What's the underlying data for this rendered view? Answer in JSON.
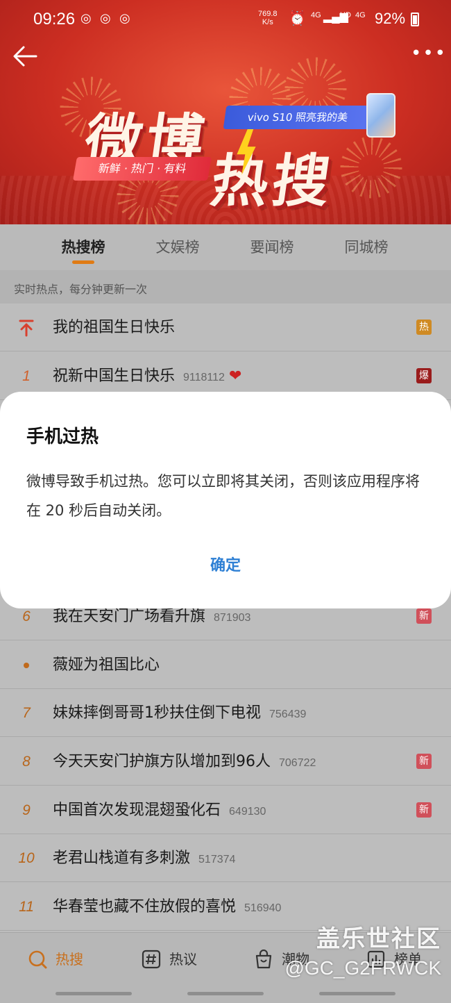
{
  "status_bar": {
    "time": "09:26",
    "net_speed_value": "769.8",
    "net_speed_unit": "K/s",
    "signal1": "4G",
    "hd": "HD",
    "signal2": "4G",
    "battery": "92%",
    "notification_icons": [
      "weibo-icon",
      "weibo-icon",
      "weibo-icon"
    ]
  },
  "banner": {
    "title_line1": "微博",
    "title_line2": "热搜",
    "slogan": "新鲜 · 热门 · 有料",
    "ad_text": "vivo S10 照亮我的美"
  },
  "tabs": [
    {
      "label": "热搜榜",
      "active": true
    },
    {
      "label": "文娱榜",
      "active": false
    },
    {
      "label": "要闻榜",
      "active": false
    },
    {
      "label": "同城榜",
      "active": false
    }
  ],
  "subinfo": "实时热点，每分钟更新一次",
  "list": [
    {
      "rank": "",
      "type": "pinned",
      "title": "我的祖国生日快乐",
      "count": "",
      "tag": "热",
      "tag_type": "hot"
    },
    {
      "rank": "1",
      "type": "num",
      "title": "祝新中国生日快乐",
      "count": "9118112",
      "heart": "❤",
      "tag": "爆",
      "tag_type": "boom"
    },
    {
      "rank": "6",
      "type": "num",
      "title": "我在天安门广场看升旗",
      "count": "871903",
      "tag": "新",
      "tag_type": "new"
    },
    {
      "rank": "",
      "type": "dot",
      "title": "薇娅为祖国比心",
      "count": "",
      "tag": "",
      "tag_type": ""
    },
    {
      "rank": "7",
      "type": "num",
      "title": "妹妹摔倒哥哥1秒扶住倒下电视",
      "count": "756439",
      "tag": "",
      "tag_type": ""
    },
    {
      "rank": "8",
      "type": "num",
      "title": "今天天安门护旗方队增加到96人",
      "count": "706722",
      "tag": "新",
      "tag_type": "new"
    },
    {
      "rank": "9",
      "type": "num",
      "title": "中国首次发现混翅蛩化石",
      "count": "649130",
      "tag": "新",
      "tag_type": "new"
    },
    {
      "rank": "10",
      "type": "num",
      "title": "老君山栈道有多刺激",
      "count": "517374",
      "tag": "",
      "tag_type": ""
    },
    {
      "rank": "11",
      "type": "num",
      "title": "华春莹也藏不住放假的喜悦",
      "count": "516940",
      "tag": "",
      "tag_type": ""
    }
  ],
  "dialog": {
    "title": "手机过热",
    "message": "微博导致手机过热。您可以立即将其关闭，否则该应用程序将在 20 秒后自动关闭。",
    "ok_label": "确定"
  },
  "bottom_nav": [
    {
      "label": "热搜",
      "icon": "hot-search-icon",
      "active": true
    },
    {
      "label": "热议",
      "icon": "hashtag-icon",
      "active": false
    },
    {
      "label": "潮物",
      "icon": "shopping-bag-icon",
      "active": false
    },
    {
      "label": "榜单",
      "icon": "ranking-icon",
      "active": false
    }
  ],
  "watermark": {
    "line1": "盖乐世社区",
    "line2": "@GC_G2FRWCK"
  },
  "colors": {
    "banner_red": "#cc2e22",
    "accent_orange": "#e07b14",
    "dialog_button_blue": "#2d7fd4",
    "dim_overlay": "#bdbdbd"
  }
}
